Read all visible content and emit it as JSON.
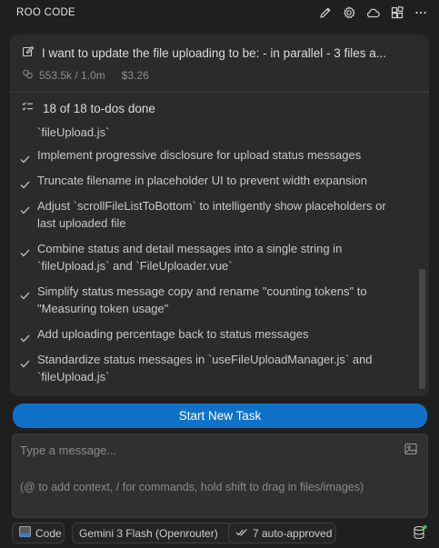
{
  "header": {
    "title": "ROO CODE",
    "icons": [
      "edit-icon",
      "settings-gear-icon",
      "cloud-icon",
      "extensions-icon",
      "more-icon"
    ]
  },
  "task": {
    "title": "I want to update the file uploading to be: - in parallel - 3 files a...",
    "tokens": "553.5k / 1.0m",
    "cost": "$3.26"
  },
  "todos": {
    "summary": "18 of 18 to-dos done",
    "partial_item": "`fileUpload.js`",
    "items": [
      "Implement progressive disclosure for upload status messages",
      "Truncate filename in placeholder UI to prevent width expansion",
      "Adjust `scrollFileListToBottom` to intelligently show placeholders or last uploaded file",
      "Combine status and detail messages into a single string in `fileUpload.js` and `FileUploader.vue`",
      "Simplify status message copy and rename \"counting tokens\" to \"Measuring token usage\"",
      "Add uploading percentage back to status messages",
      "Standardize status messages in `useFileUploadManager.js` and `fileUpload.js`"
    ]
  },
  "actions": {
    "new_task": "Start New Task"
  },
  "composer": {
    "placeholder": "Type a message...",
    "hint": "(@ to add context, / for commands, hold shift to drag in files/images)"
  },
  "bottom_bar": {
    "mode": "Code",
    "model": "Gemini 3 Flash (Openrouter)",
    "auto_approved": "7 auto-approved"
  },
  "colors": {
    "accent": "#0f72c8",
    "status_dot": "#3fb950"
  }
}
